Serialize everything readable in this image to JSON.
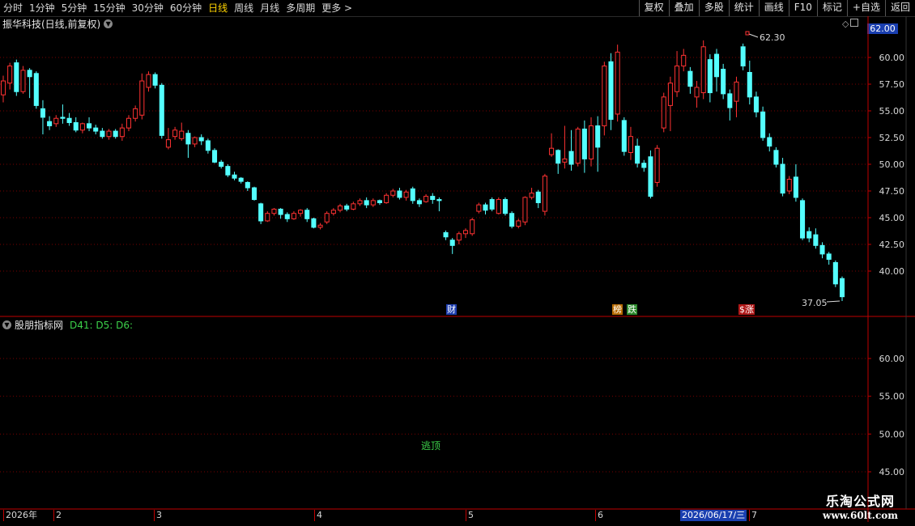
{
  "toolbar": {
    "periods": [
      "分时",
      "1分钟",
      "5分钟",
      "15分钟",
      "30分钟",
      "60分钟",
      "日线",
      "周线",
      "月线",
      "多周期",
      "更多 >"
    ],
    "active_period": "日线",
    "right_buttons": [
      "复权",
      "叠加",
      "多股",
      "统计",
      "画线",
      "F10",
      "标记",
      "+自选",
      "返回"
    ]
  },
  "main_title": "振华科技(日线,前复权)",
  "indicator_title": "股朋指标网",
  "indicator_values": "D41: D5: D6:",
  "current_price_tag": "62.00",
  "high_annotation": "62.30",
  "low_annotation": "37.05",
  "signal_text": "逃顶",
  "event_tags": [
    {
      "text": "财",
      "color": "#1f3fb0"
    },
    {
      "text": "榜",
      "color": "#b86b00"
    },
    {
      "text": "跌",
      "color": "#2d8a2d"
    },
    {
      "text": "$",
      "color": "#b01818"
    },
    {
      "text": "涨",
      "color": "#b01818"
    }
  ],
  "price_axis": [
    "60.00",
    "57.50",
    "55.00",
    "52.50",
    "50.00",
    "47.50",
    "45.00",
    "42.50",
    "40.00"
  ],
  "indicator_axis": [
    "60.00",
    "55.00",
    "50.00",
    "45.00"
  ],
  "timeline": {
    "labels": [
      "2026年",
      "2",
      "3",
      "4",
      "5",
      "6",
      "7"
    ],
    "selected_date": "2026/06/17/三"
  },
  "watermark": {
    "line1": "乐淘公式网",
    "line2": "www.60lt.com"
  },
  "colors": {
    "up": "#ff3232",
    "down": "#54ffff",
    "grid": "#7a0000",
    "axis": "#c00000"
  },
  "chart_data": {
    "type": "candlestick",
    "ylim": [
      36.5,
      63.0
    ],
    "candles": [
      [
        56.5,
        57.8,
        58.3,
        55.8
      ],
      [
        57.6,
        59.2,
        59.5,
        57.0
      ],
      [
        59.5,
        56.8,
        59.8,
        56.4
      ],
      [
        56.8,
        58.8,
        59.2,
        56.6
      ],
      [
        58.8,
        58.2,
        59.0,
        56.2
      ],
      [
        58.5,
        55.5,
        58.7,
        55.2
      ],
      [
        55.2,
        54.4,
        56.0,
        52.8
      ],
      [
        54.0,
        53.6,
        54.5,
        53.2
      ],
      [
        53.8,
        54.3,
        54.6,
        53.5
      ],
      [
        54.4,
        54.3,
        55.6,
        53.8
      ],
      [
        54.3,
        53.9,
        54.8,
        53.6
      ],
      [
        53.9,
        53.2,
        54.4,
        53.0
      ],
      [
        53.2,
        53.8,
        53.9,
        52.9
      ],
      [
        53.8,
        53.4,
        54.4,
        53.1
      ],
      [
        53.4,
        53.1,
        53.7,
        52.8
      ],
      [
        53.1,
        52.6,
        53.4,
        52.4
      ],
      [
        52.6,
        53.1,
        53.3,
        52.3
      ],
      [
        53.1,
        52.6,
        53.3,
        52.4
      ],
      [
        52.6,
        53.4,
        53.8,
        52.2
      ],
      [
        53.4,
        54.3,
        54.6,
        53.1
      ],
      [
        54.3,
        55.2,
        55.5,
        54.0
      ],
      [
        54.6,
        57.8,
        58.5,
        54.2
      ],
      [
        57.2,
        58.4,
        58.7,
        56.8
      ],
      [
        58.4,
        57.4,
        58.6,
        57.1
      ],
      [
        57.4,
        52.7,
        57.6,
        52.4
      ],
      [
        51.6,
        52.3,
        53.4,
        51.4
      ],
      [
        52.6,
        53.2,
        53.5,
        52.3
      ],
      [
        52.4,
        53.1,
        53.9,
        52.2
      ],
      [
        52.9,
        51.9,
        53.2,
        50.6
      ],
      [
        51.9,
        52.5,
        52.6,
        51.6
      ],
      [
        52.5,
        52.2,
        52.8,
        51.8
      ],
      [
        52.2,
        51.3,
        52.4,
        51.0
      ],
      [
        51.3,
        50.2,
        51.5,
        50.1
      ],
      [
        50.2,
        49.8,
        50.4,
        49.6
      ],
      [
        49.8,
        49.0,
        50.0,
        48.8
      ],
      [
        49.0,
        48.7,
        49.3,
        48.5
      ],
      [
        48.7,
        48.4,
        48.8,
        48.2
      ],
      [
        48.3,
        47.8,
        48.4,
        47.5
      ],
      [
        47.8,
        46.7,
        47.9,
        46.6
      ],
      [
        46.3,
        44.7,
        46.4,
        44.4
      ],
      [
        44.7,
        45.4,
        45.6,
        44.6
      ],
      [
        45.4,
        45.8,
        45.9,
        45.2
      ],
      [
        45.8,
        45.3,
        45.9,
        44.9
      ],
      [
        45.3,
        44.9,
        45.5,
        44.6
      ],
      [
        44.9,
        45.4,
        45.6,
        44.8
      ],
      [
        45.4,
        45.7,
        45.8,
        45.1
      ],
      [
        45.7,
        44.9,
        45.9,
        44.6
      ],
      [
        44.9,
        44.1,
        45.0,
        44.0
      ],
      [
        44.1,
        44.3,
        44.5,
        43.9
      ],
      [
        44.6,
        45.4,
        45.6,
        44.4
      ],
      [
        45.4,
        45.7,
        45.9,
        45.2
      ],
      [
        45.7,
        46.1,
        46.3,
        45.5
      ],
      [
        46.1,
        45.8,
        46.3,
        45.6
      ],
      [
        45.8,
        46.3,
        46.5,
        45.7
      ],
      [
        46.3,
        46.6,
        46.8,
        46.1
      ],
      [
        46.6,
        46.2,
        46.9,
        45.9
      ],
      [
        46.2,
        46.6,
        46.8,
        46.0
      ],
      [
        46.6,
        46.4,
        46.7,
        46.2
      ],
      [
        46.4,
        47.1,
        47.3,
        46.3
      ],
      [
        47.1,
        47.5,
        47.7,
        46.9
      ],
      [
        47.5,
        46.9,
        47.8,
        46.7
      ],
      [
        46.9,
        47.4,
        47.6,
        46.6
      ],
      [
        47.7,
        46.6,
        47.9,
        46.3
      ],
      [
        46.6,
        46.3,
        46.8,
        46.0
      ],
      [
        46.5,
        47.0,
        47.2,
        46.4
      ],
      [
        47.0,
        46.7,
        47.3,
        46.3
      ],
      [
        46.7,
        46.6,
        46.9,
        45.6
      ],
      [
        43.6,
        43.2,
        43.8,
        42.9
      ],
      [
        42.9,
        42.4,
        43.1,
        41.6
      ],
      [
        42.9,
        43.5,
        43.7,
        42.5
      ],
      [
        43.5,
        43.8,
        44.0,
        43.1
      ],
      [
        43.5,
        44.8,
        45.0,
        43.3
      ],
      [
        45.6,
        46.2,
        46.4,
        45.4
      ],
      [
        46.2,
        45.7,
        46.4,
        45.3
      ],
      [
        46.7,
        45.8,
        46.9,
        45.6
      ],
      [
        45.4,
        46.7,
        46.9,
        45.3
      ],
      [
        46.7,
        45.4,
        46.9,
        45.2
      ],
      [
        45.4,
        44.2,
        45.6,
        44.0
      ],
      [
        44.2,
        44.7,
        44.9,
        44.0
      ],
      [
        44.6,
        46.9,
        47.0,
        44.3
      ],
      [
        46.9,
        47.3,
        47.8,
        46.7
      ],
      [
        47.4,
        46.4,
        47.6,
        45.9
      ],
      [
        45.6,
        48.9,
        49.1,
        45.2
      ],
      [
        50.9,
        51.5,
        52.9,
        50.7
      ],
      [
        51.3,
        50.1,
        51.4,
        49.1
      ],
      [
        50.2,
        50.5,
        53.6,
        49.6
      ],
      [
        51.2,
        50.0,
        53.2,
        49.4
      ],
      [
        50.1,
        53.3,
        53.5,
        49.8
      ],
      [
        53.3,
        50.5,
        54.1,
        49.2
      ],
      [
        50.5,
        53.6,
        54.4,
        49.8
      ],
      [
        53.6,
        51.6,
        54.5,
        49.3
      ],
      [
        53.6,
        59.2,
        59.6,
        52.7
      ],
      [
        59.6,
        54.2,
        60.4,
        53.2
      ],
      [
        54.7,
        60.5,
        61.2,
        54.0
      ],
      [
        54.1,
        51.2,
        54.4,
        50.8
      ],
      [
        51.1,
        52.6,
        53.5,
        50.4
      ],
      [
        51.7,
        50.1,
        52.4,
        49.7
      ],
      [
        50.1,
        49.7,
        50.4,
        49.3
      ],
      [
        50.7,
        47.0,
        51.3,
        46.8
      ],
      [
        48.3,
        51.5,
        51.8,
        47.9
      ],
      [
        53.4,
        56.3,
        56.7,
        53.0
      ],
      [
        55.5,
        57.6,
        58.2,
        53.1
      ],
      [
        56.8,
        59.2,
        60.6,
        56.3
      ],
      [
        59.2,
        60.2,
        60.8,
        58.7
      ],
      [
        58.7,
        57.3,
        59.1,
        56.6
      ],
      [
        56.3,
        57.2,
        57.8,
        55.3
      ],
      [
        56.7,
        61.0,
        61.6,
        56.1
      ],
      [
        59.8,
        56.7,
        60.3,
        55.8
      ],
      [
        60.3,
        58.2,
        60.8,
        56.8
      ],
      [
        58.9,
        56.6,
        59.4,
        56.1
      ],
      [
        56.6,
        55.3,
        57.0,
        54.1
      ],
      [
        55.9,
        57.7,
        58.2,
        54.4
      ],
      [
        61.0,
        59.2,
        61.3,
        58.8
      ],
      [
        58.6,
        56.3,
        59.7,
        55.6
      ],
      [
        56.3,
        54.9,
        56.8,
        54.4
      ],
      [
        54.9,
        52.5,
        55.4,
        52.2
      ],
      [
        52.5,
        51.7,
        52.9,
        51.2
      ],
      [
        51.3,
        50.0,
        51.6,
        49.7
      ],
      [
        50.0,
        47.3,
        50.6,
        47.0
      ],
      [
        47.5,
        48.6,
        48.9,
        47.2
      ],
      [
        48.8,
        46.9,
        50.0,
        46.5
      ],
      [
        46.6,
        43.1,
        46.8,
        42.9
      ],
      [
        43.7,
        43.1,
        44.1,
        42.7
      ],
      [
        43.4,
        42.4,
        44.0,
        42.1
      ],
      [
        42.4,
        41.6,
        42.7,
        41.2
      ],
      [
        41.6,
        41.1,
        41.8,
        40.6
      ],
      [
        40.8,
        38.8,
        41.0,
        38.5
      ],
      [
        39.3,
        37.6,
        39.5,
        37.2
      ]
    ]
  }
}
